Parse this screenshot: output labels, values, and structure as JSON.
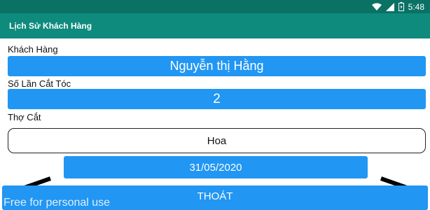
{
  "status_bar": {
    "time": "5:48"
  },
  "app_bar": {
    "title": "Lịch Sử Khách Hàng"
  },
  "form": {
    "customer_label": "Khách Hàng",
    "customer_value": "Nguyễn thị Hằng",
    "haircut_count_label": "Số Lần Cắt Tóc",
    "haircut_count_value": "2",
    "barber_label": "Thợ Cắt",
    "barber_value": "Hoa"
  },
  "navigation": {
    "prev_icon": "chevron-left-icon",
    "next_icon": "chevron-right-icon",
    "date": "31/05/2020"
  },
  "exit_button": {
    "label": "THOÁT"
  },
  "watermark": "Free for personal use",
  "colors": {
    "status_bar": "#0a7165",
    "app_bar": "#0e8b7d",
    "accent_blue": "#2196f3"
  }
}
